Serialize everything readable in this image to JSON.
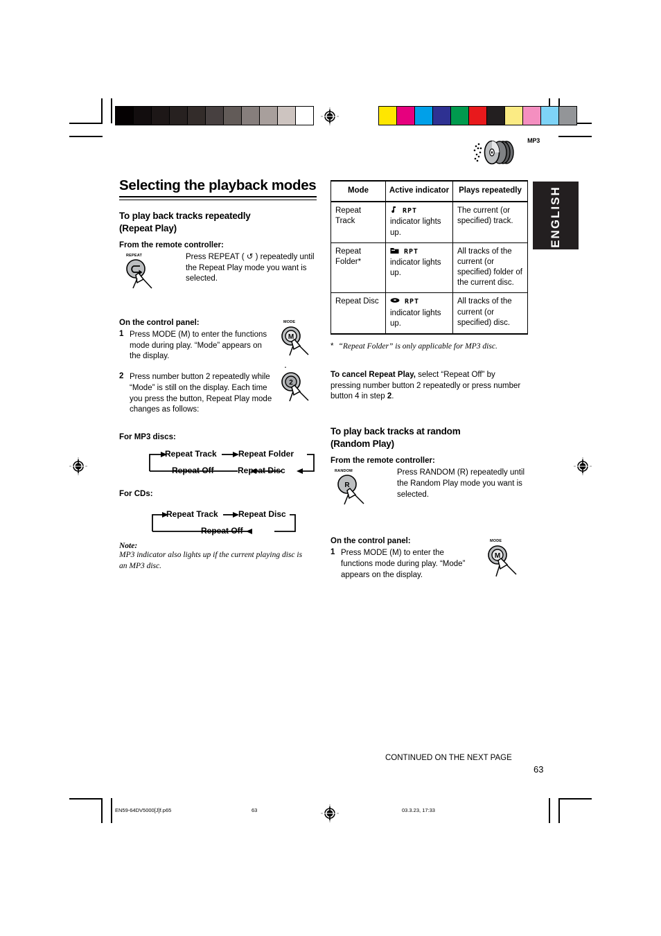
{
  "page": {
    "language_tab": "ENGLISH",
    "page_number": "63",
    "continued_note": "CONTINUED ON THE NEXT PAGE",
    "disc_logo_label": "MP3"
  },
  "colorbars": {
    "grayscale": [
      "#050102",
      "#120d0e",
      "#1d1717",
      "#272120",
      "#332c2a",
      "#474040",
      "#625b58",
      "#867e7c",
      "#a89f9c",
      "#cdc4c0",
      "#ffffff"
    ],
    "process": [
      "#ffe600",
      "#e6007e",
      "#00a0e9",
      "#2e3192",
      "#009a4e",
      "#e8191c",
      "#231f20",
      "#fbeb84",
      "#f48fc0",
      "#7ed3f7",
      "#939598"
    ]
  },
  "title": "Selecting the playback modes",
  "repeat_section": {
    "heading_line1": "To play back tracks repeatedly",
    "heading_line2": "(Repeat Play)",
    "remote_lead": "From the remote controller:",
    "remote_button_caption": "REPEAT",
    "remote_text": "Press REPEAT ( ↺ ) repeatedly until the Repeat Play mode you want is selected.",
    "panel_lead": "On the control panel:",
    "steps": [
      {
        "num": "1",
        "text": "Press MODE (M) to enter the functions mode during play. “Mode” appears on the display.",
        "button_caption": "MODE",
        "button_label": "M"
      },
      {
        "num": "2",
        "text": "Press number button 2 repeatedly while “Mode” is still on the display. Each time you press the button, Repeat Play mode changes as follows:",
        "button_caption": "2",
        "button_label": "2"
      }
    ]
  },
  "flow_mp3": {
    "caption": "For MP3 discs:",
    "nodes": [
      "Repeat Track",
      "Repeat Folder",
      "Repeat Disc",
      "Repeat Off"
    ]
  },
  "flow_cd": {
    "caption": "For CDs:",
    "nodes": [
      "Repeat Track",
      "Repeat Disc",
      "Repeat Off"
    ]
  },
  "note": {
    "label": "Note:",
    "text": "MP3 indicator also lights up if the current playing disc is an MP3 disc."
  },
  "modes_table": {
    "headers": [
      "Mode",
      "Active indicator",
      "Plays repeatedly"
    ],
    "rows": [
      {
        "mode": "Repeat Track",
        "indicator_icon": "music-note",
        "indicator_text": "RPT",
        "indicator_note": "indicator lights up.",
        "plays": "The current (or specified) track."
      },
      {
        "mode": "Repeat Folder*",
        "indicator_icon": "folder",
        "indicator_text": "RPT",
        "indicator_note": "indicator lights up.",
        "plays": "All tracks of the current (or specified) folder of the current disc."
      },
      {
        "mode": "Repeat Disc",
        "indicator_icon": "disc",
        "indicator_text": "RPT",
        "indicator_note": "indicator lights up.",
        "plays": "All tracks of the current (or specified) disc."
      }
    ],
    "footnote_marker": "*",
    "footnote": "“Repeat Folder” is only applicable for MP3 disc."
  },
  "cancel_note": {
    "bold": "To cancel Repeat Play,",
    "rest": " select “Repeat Off” by pressing number button 2 repeatedly or press number button 4 in step ",
    "step_bold": "2",
    "end": "."
  },
  "random_section": {
    "heading_line1": "To play back tracks at random",
    "heading_line2": "(Random Play)",
    "remote_lead": "From the remote controller:",
    "remote_button_caption": "RANDOM",
    "remote_button_label": "R",
    "remote_text": "Press RANDOM (R) repeatedly until the Random Play mode you want is selected.",
    "panel_lead": "On the control panel:",
    "step": {
      "num": "1",
      "text": "Press MODE (M) to enter the functions mode during play. “Mode” appears on the display.",
      "button_caption": "MODE",
      "button_label": "M"
    }
  },
  "print_footer": {
    "filename": "EN59-64DV5000[J]f.p65",
    "page": "63",
    "timestamp": "03.3.23, 17:33"
  }
}
